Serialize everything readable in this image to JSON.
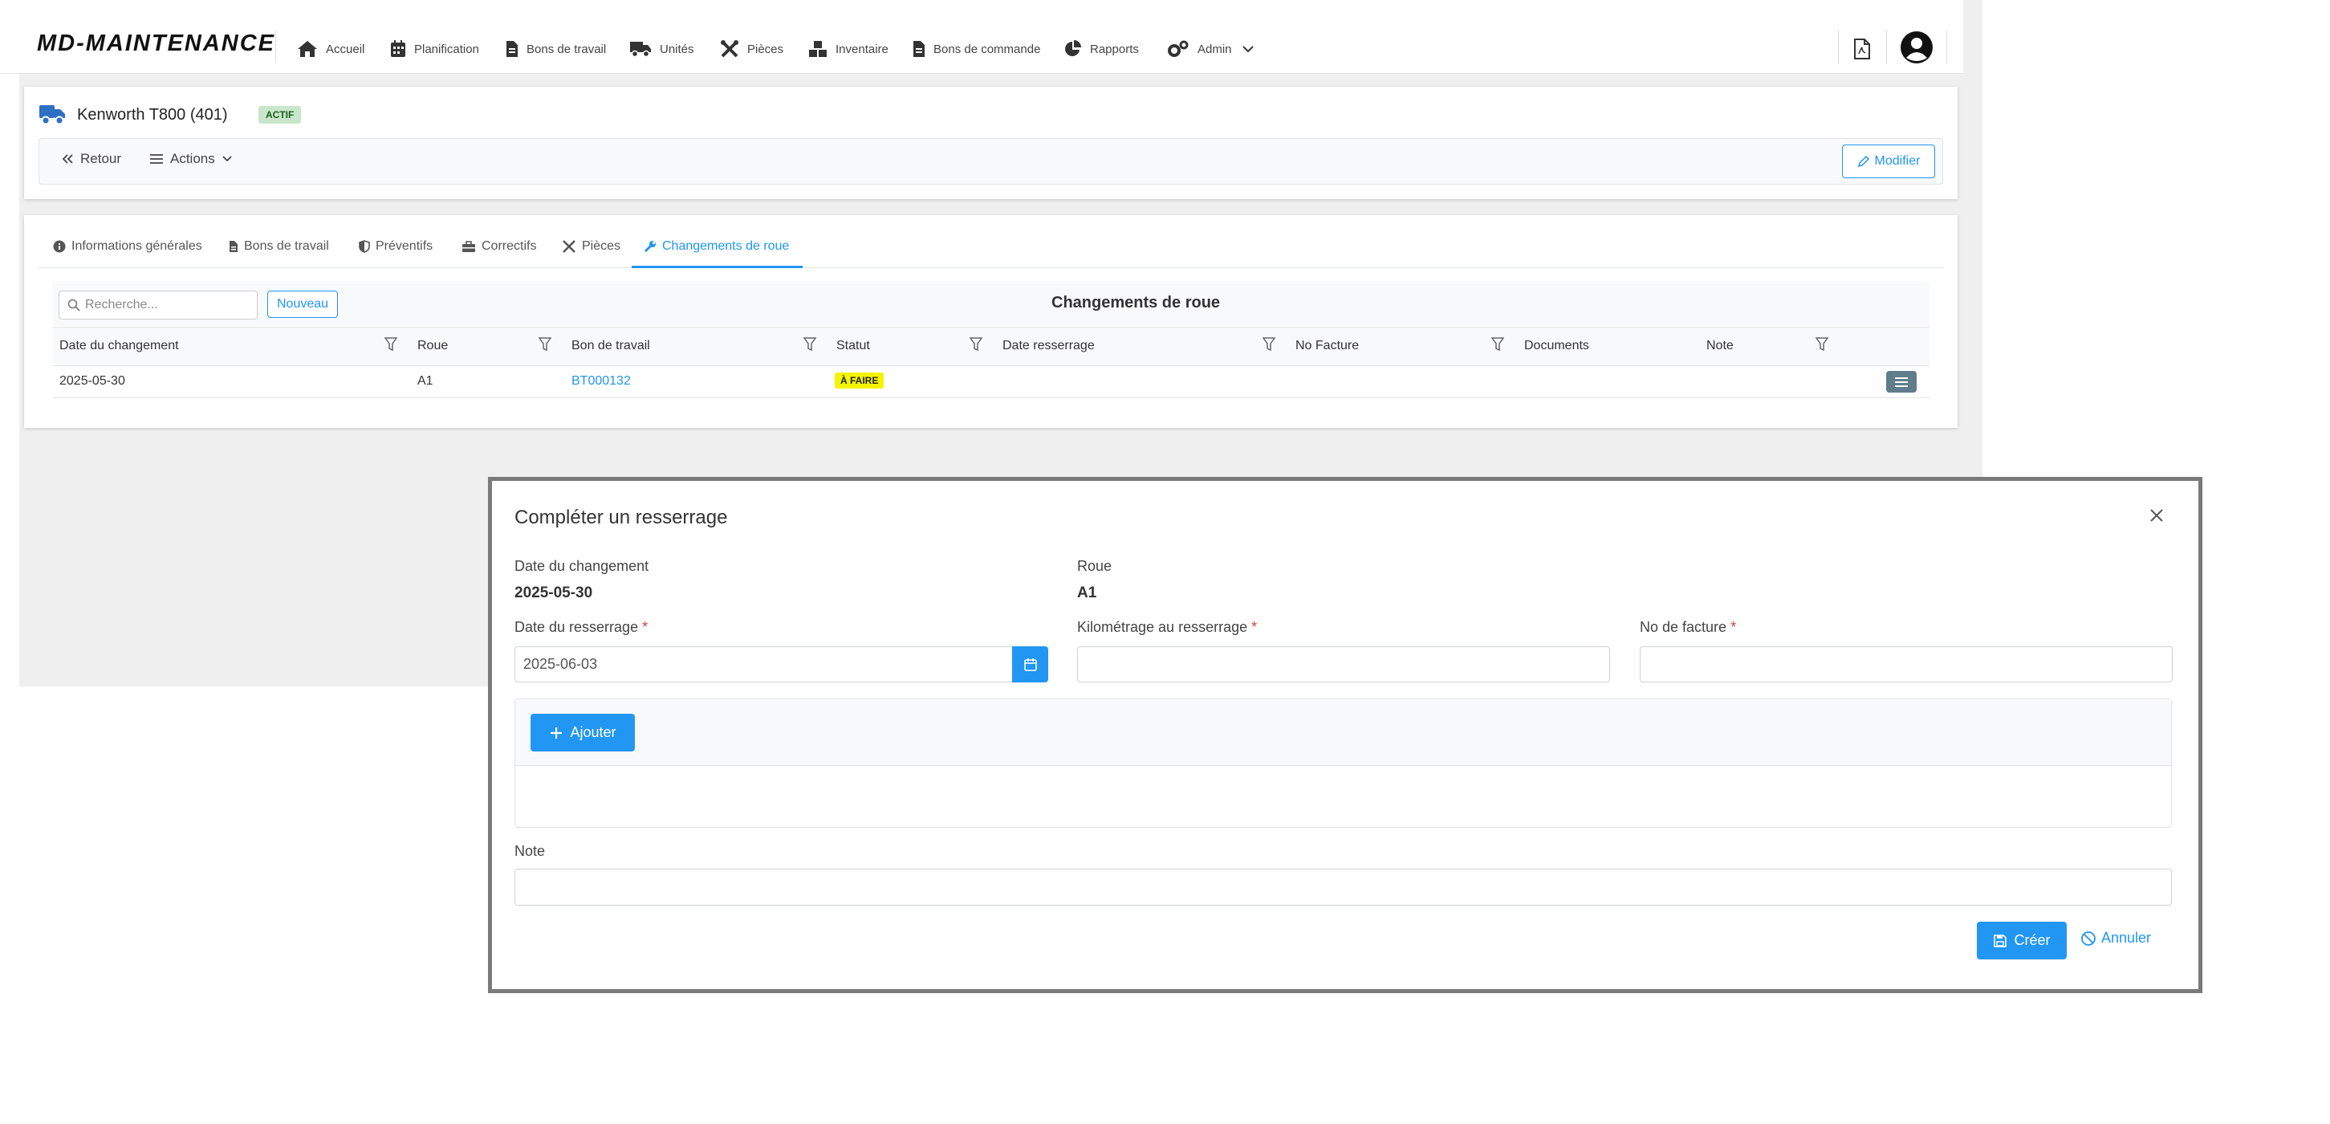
{
  "app": {
    "logo": "MD-MAINTENANCE"
  },
  "nav": {
    "items": [
      {
        "label": "Accueil",
        "icon": "home-icon"
      },
      {
        "label": "Planification",
        "icon": "calendar-icon"
      },
      {
        "label": "Bons de travail",
        "icon": "document-icon"
      },
      {
        "label": "Unités",
        "icon": "truck-icon"
      },
      {
        "label": "Pièces",
        "icon": "tools-icon"
      },
      {
        "label": "Inventaire",
        "icon": "boxes-icon"
      },
      {
        "label": "Bons de commande",
        "icon": "document-icon"
      },
      {
        "label": "Rapports",
        "icon": "pie-chart-icon"
      },
      {
        "label": "Admin",
        "icon": "gears-icon"
      }
    ]
  },
  "unit": {
    "title": "Kenworth T800 (401)",
    "status": "ACTIF"
  },
  "toolbar": {
    "back": "Retour",
    "actions": "Actions",
    "edit": "Modifier"
  },
  "tabs": [
    {
      "label": "Informations générales",
      "icon": "info-icon"
    },
    {
      "label": "Bons de travail",
      "icon": "document-icon"
    },
    {
      "label": "Préventifs",
      "icon": "shield-icon"
    },
    {
      "label": "Correctifs",
      "icon": "toolbox-icon"
    },
    {
      "label": "Pièces",
      "icon": "tools-icon"
    },
    {
      "label": "Changements de roue",
      "icon": "wrench-icon",
      "active": true
    }
  ],
  "table": {
    "search_placeholder": "Recherche...",
    "new_button": "Nouveau",
    "title": "Changements de roue",
    "columns": [
      "Date du changement",
      "Roue",
      "Bon de travail",
      "Statut",
      "Date resserrage",
      "No Facture",
      "Documents",
      "Note"
    ],
    "rows": [
      {
        "date": "2025-05-30",
        "roue": "A1",
        "bon": "BT000132",
        "statut": "À FAIRE",
        "date_resserrage": "",
        "facture": "",
        "documents": "",
        "note": ""
      }
    ]
  },
  "modal": {
    "title": "Compléter un resserrage",
    "date_changement_label": "Date du changement",
    "date_changement_value": "2025-05-30",
    "roue_label": "Roue",
    "roue_value": "A1",
    "date_resserrage_label": "Date du resserrage",
    "date_resserrage_value": "2025-06-03",
    "km_label": "Kilométrage au resserrage",
    "km_value": "",
    "facture_label": "No de facture",
    "facture_value": "",
    "add_button": "Ajouter",
    "note_label": "Note",
    "note_value": "",
    "create_button": "Créer",
    "cancel_button": "Annuler",
    "required_mark": "*"
  },
  "colors": {
    "accent": "#2196f3",
    "status_active": "#c8e6c9",
    "status_todo": "#f4f300"
  }
}
